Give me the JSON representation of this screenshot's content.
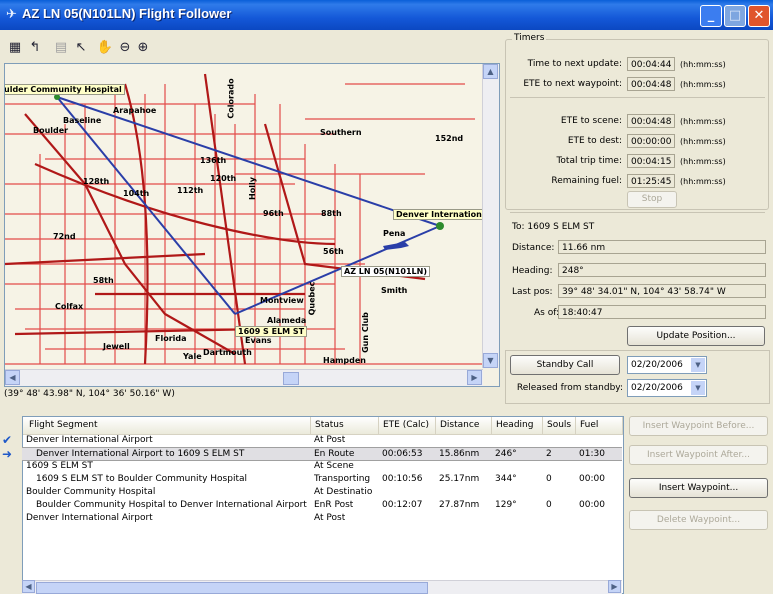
{
  "window": {
    "title": "AZ LN 05(N101LN) Flight Follower",
    "app_icon": "flight-icon",
    "controls": [
      "minimize",
      "maximize",
      "close"
    ]
  },
  "toolbar": {
    "tools": [
      {
        "name": "map-layers-icon",
        "enabled": true
      },
      {
        "name": "undo-icon",
        "enabled": true
      },
      {
        "name": "erase-icon",
        "enabled": false
      },
      {
        "name": "pointer-icon",
        "enabled": true
      },
      {
        "name": "pan-hand-icon",
        "enabled": true
      },
      {
        "name": "zoom-out-icon",
        "enabled": true
      },
      {
        "name": "zoom-in-icon",
        "enabled": true
      }
    ]
  },
  "map": {
    "labels": {
      "boulder_hospital": "ulder Community Hospital",
      "denver_airport": "Denver Internationa",
      "aircraft": "AZ LN 05(N101LN)",
      "scene": "1609 S ELM ST",
      "places": [
        "Arapahoe",
        "Southern",
        "152nd",
        "Pena",
        "Smith",
        "Alameda",
        "Hampden",
        "Montview",
        "Colfax",
        "Yale",
        "Dartmouth",
        "Evans",
        "Florida",
        "Jewell",
        "Baseline",
        "Boulder",
        "104th",
        "120th",
        "128th",
        "136th",
        "112th",
        "96th",
        "88th",
        "72nd",
        "58th",
        "56th",
        "Quebec",
        "Holly",
        "Colorado",
        "Gun Club"
      ]
    },
    "coordinates_readout": "(39° 48' 43.98\" N, 104° 36' 50.16\" W)"
  },
  "timers": {
    "legend": "Timers",
    "next_update": {
      "label": "Time to next update:",
      "value": "00:04:44",
      "unit": "(hh:mm:ss)"
    },
    "next_waypoint": {
      "label": "ETE to next waypoint:",
      "value": "00:04:48",
      "unit": "(hh:mm:ss)"
    },
    "to_scene": {
      "label": "ETE to scene:",
      "value": "00:04:48",
      "unit": "(hh:mm:ss)"
    },
    "to_dest": {
      "label": "ETE to dest:",
      "value": "00:00:00",
      "unit": "(hh:mm:ss)"
    },
    "total_trip": {
      "label": "Total trip time:",
      "value": "00:04:15",
      "unit": "(hh:mm:ss)"
    },
    "remaining_fuel": {
      "label": "Remaining fuel:",
      "value": "01:25:45",
      "unit": "(hh:mm:ss)"
    },
    "stop_label": "Stop"
  },
  "position": {
    "to": "To: 1609 S ELM ST",
    "distance_label": "Distance:",
    "distance": "11.66 nm",
    "heading_label": "Heading:",
    "heading": "248°",
    "last_pos_label": "Last pos:",
    "last_pos": "39° 48' 34.01\" N, 104° 43' 58.74\" W",
    "as_of_label": "As of:",
    "as_of": "18:40:47",
    "update_label": "Update Position..."
  },
  "standby": {
    "call_label": "Standby Call",
    "call_date": "02/20/2006",
    "released_label": "Released from standby:",
    "released_date": "02/20/2006"
  },
  "segments": {
    "columns": [
      "Flight Segment",
      "Status",
      "ETE (Calc)",
      "Distance",
      "Heading",
      "Souls",
      "Fuel"
    ],
    "rows": [
      {
        "marker": "check",
        "indent": false,
        "segment": "Denver International Airport",
        "status": "At Post",
        "ete": "",
        "distance": "",
        "heading": "",
        "souls": "",
        "fuel": ""
      },
      {
        "marker": "arrow",
        "indent": true,
        "segment": "Denver International Airport to 1609 S ELM ST",
        "status": "En Route",
        "ete": "00:06:53",
        "distance": "15.86nm",
        "heading": "246°",
        "souls": "2",
        "fuel": "01:30",
        "selected": true
      },
      {
        "marker": "",
        "indent": false,
        "segment": "1609 S ELM ST",
        "status": "At Scene",
        "ete": "",
        "distance": "",
        "heading": "",
        "souls": "",
        "fuel": ""
      },
      {
        "marker": "",
        "indent": true,
        "segment": "1609 S ELM ST to Boulder Community Hospital",
        "status": "Transporting",
        "ete": "00:10:56",
        "distance": "25.17nm",
        "heading": "344°",
        "souls": "0",
        "fuel": "00:00"
      },
      {
        "marker": "",
        "indent": false,
        "segment": "Boulder Community Hospital",
        "status": "At Destinatio",
        "ete": "",
        "distance": "",
        "heading": "",
        "souls": "",
        "fuel": ""
      },
      {
        "marker": "",
        "indent": true,
        "segment": "Boulder Community Hospital to Denver International Airport",
        "status": "EnR Post",
        "ete": "00:12:07",
        "distance": "27.87nm",
        "heading": "129°",
        "souls": "0",
        "fuel": "00:00"
      },
      {
        "marker": "",
        "indent": false,
        "segment": "Denver International Airport",
        "status": "At Post",
        "ete": "",
        "distance": "",
        "heading": "",
        "souls": "",
        "fuel": ""
      }
    ]
  },
  "waypoint_buttons": {
    "insert_before": "Insert Waypoint Before...",
    "insert_after": "Insert Waypoint After...",
    "insert": "Insert Waypoint...",
    "delete": "Delete Waypoint..."
  }
}
